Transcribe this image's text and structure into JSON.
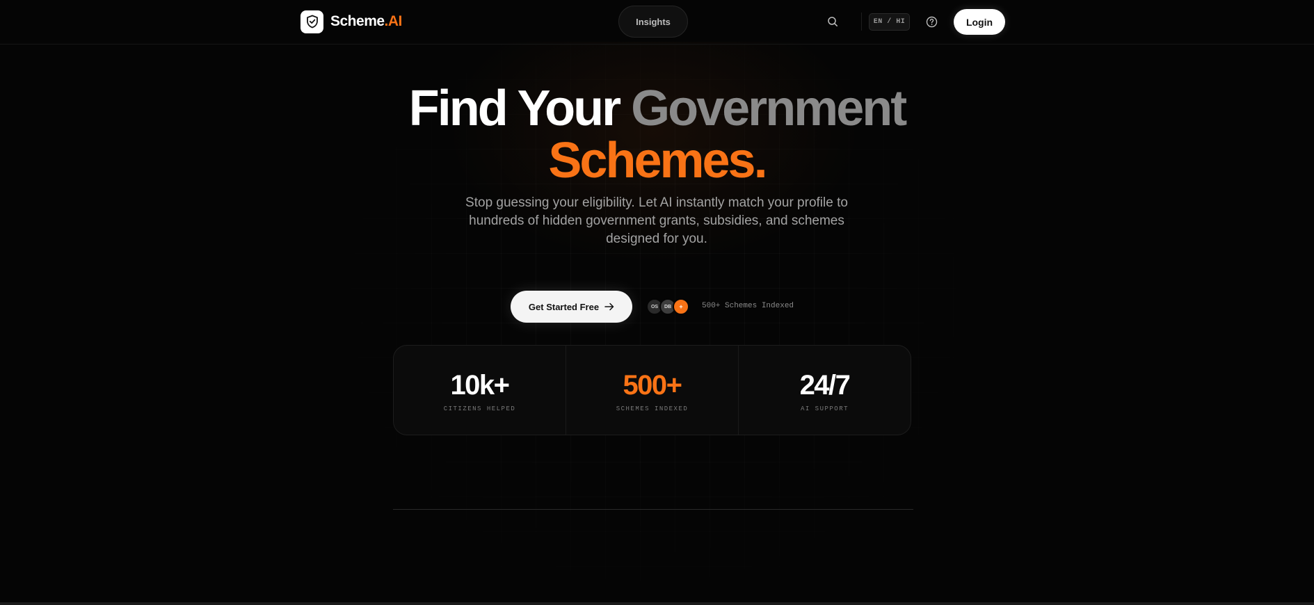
{
  "colors": {
    "background": "#050505",
    "accent": "#f97316",
    "muted_heading": "#8a8a8a"
  },
  "header": {
    "logo": {
      "icon": "shield-check-icon",
      "name": "Scheme",
      "suffix": ".AI"
    },
    "nav": {
      "insights_label": "Insights"
    },
    "search_icon": "search-icon",
    "language_label": "EN / HI",
    "help_icon": "help-circle-icon",
    "login_label": "Login"
  },
  "hero": {
    "title_part1": "Find Your ",
    "title_part2": "Government",
    "title_line2": "Schemes.",
    "subtitle": "Stop guessing your eligibility. Let AI instantly match your profile to hundreds of hidden government grants, subsidies, and schemes designed for you."
  },
  "cta": {
    "button_label": "Get Started Free",
    "button_icon": "arrow-right-icon",
    "avatars": [
      "OS",
      "DB",
      "+"
    ],
    "indexed_label": "500+ Schemes Indexed"
  },
  "stats": [
    {
      "value": "10k+",
      "label": "CITIZENS HELPED",
      "highlight": false
    },
    {
      "value": "500+",
      "label": "SCHEMES INDEXED",
      "highlight": true
    },
    {
      "value": "24/7",
      "label": "AI SUPPORT",
      "highlight": false
    }
  ]
}
